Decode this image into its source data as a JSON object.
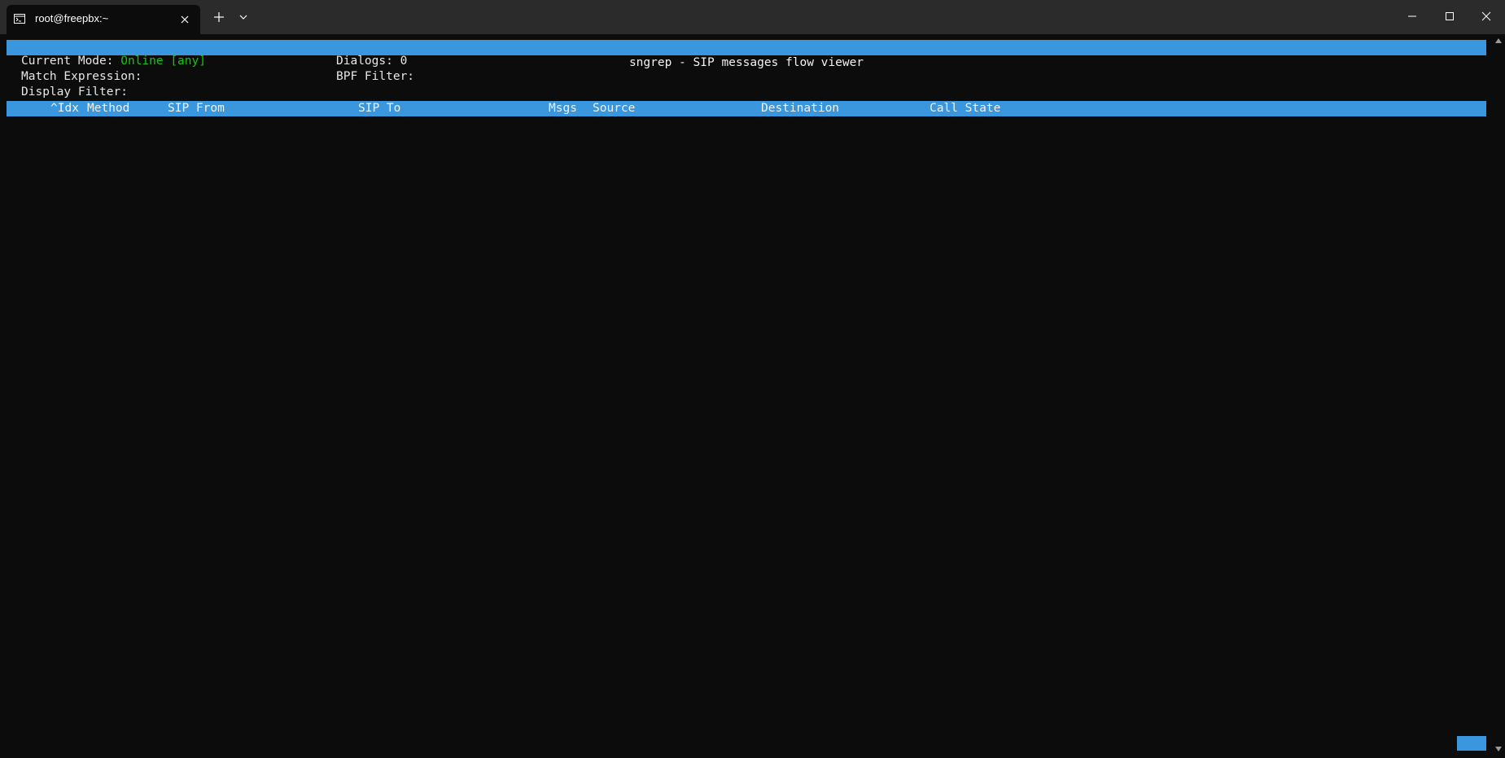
{
  "tab": {
    "title": "root@freepbx:~",
    "icon": "terminal-icon"
  },
  "titlebar": {
    "new_tab_icon": "plus-icon",
    "dropdown_icon": "chevron-down-icon",
    "minimize_icon": "minimize-icon",
    "maximize_icon": "maximize-icon",
    "close_icon": "close-icon"
  },
  "sngrep": {
    "header_title": "sngrep - SIP messages flow viewer",
    "current_mode_label": "Current Mode: ",
    "current_mode_value": "Online [any]",
    "dialogs_label": "Dialogs: 0",
    "match_expression_label": "Match Expression:",
    "bpf_filter_label": "BPF Filter:",
    "display_filter_label": "Display Filter:",
    "columns": {
      "idx": "^Idx",
      "method": "Method",
      "sip_from": "SIP From",
      "sip_to": "SIP To",
      "msgs": "Msgs",
      "source": "Source",
      "destination": "Destination",
      "call_state": "Call State"
    }
  },
  "colors": {
    "terminal_bg": "#0c0c0c",
    "titlebar_bg": "#2b2b2b",
    "accent_blue": "#3a96dd",
    "green": "#16c60c",
    "text": "#e6e6e6"
  }
}
